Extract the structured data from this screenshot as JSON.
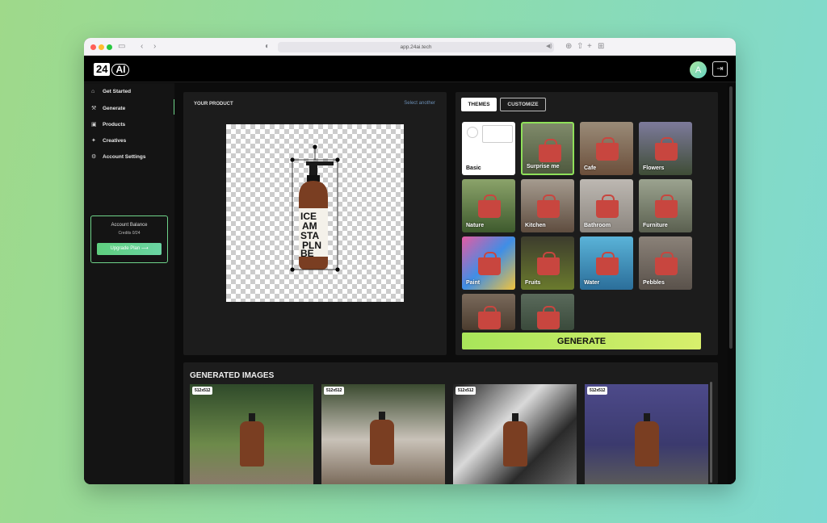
{
  "browser": {
    "url": "app.24ai.tech"
  },
  "brand": {
    "num": "24",
    "ai": "AI"
  },
  "user": {
    "avatar_letter": "A"
  },
  "sidebar": {
    "items": [
      {
        "label": "Get Started",
        "icon": "home-icon"
      },
      {
        "label": "Generate",
        "icon": "magic-wand-icon"
      },
      {
        "label": "Products",
        "icon": "bag-icon"
      },
      {
        "label": "Creatives",
        "icon": "sparkle-icon"
      },
      {
        "label": "Account Settings",
        "icon": "gear-icon"
      }
    ],
    "balance": {
      "title": "Account Balance",
      "credits": "Credits 0/24",
      "button": "Upgrade Plan ⟶"
    }
  },
  "product": {
    "title": "YOUR PRODUCT",
    "select_another": "Select another",
    "bottle_text": "ICE AM STAY PLANT BE AME"
  },
  "themes": {
    "tabs": [
      "THEMES",
      "CUSTOMIZE"
    ],
    "items": [
      "Basic",
      "Surprise me",
      "Cafe",
      "Flowers",
      "Nature",
      "Kitchen",
      "Bathroom",
      "Furniture",
      "Paint",
      "Fruits",
      "Water",
      "Pebbles",
      "",
      ""
    ],
    "generate": "GENERATE"
  },
  "generated": {
    "title": "GENERATED IMAGES",
    "images": [
      "512x512",
      "512x512",
      "512x512",
      "512x512"
    ]
  },
  "colors": {
    "accent": "#6fd48a",
    "generate_start": "#a8e55a",
    "generate_end": "#d8ef6c"
  }
}
